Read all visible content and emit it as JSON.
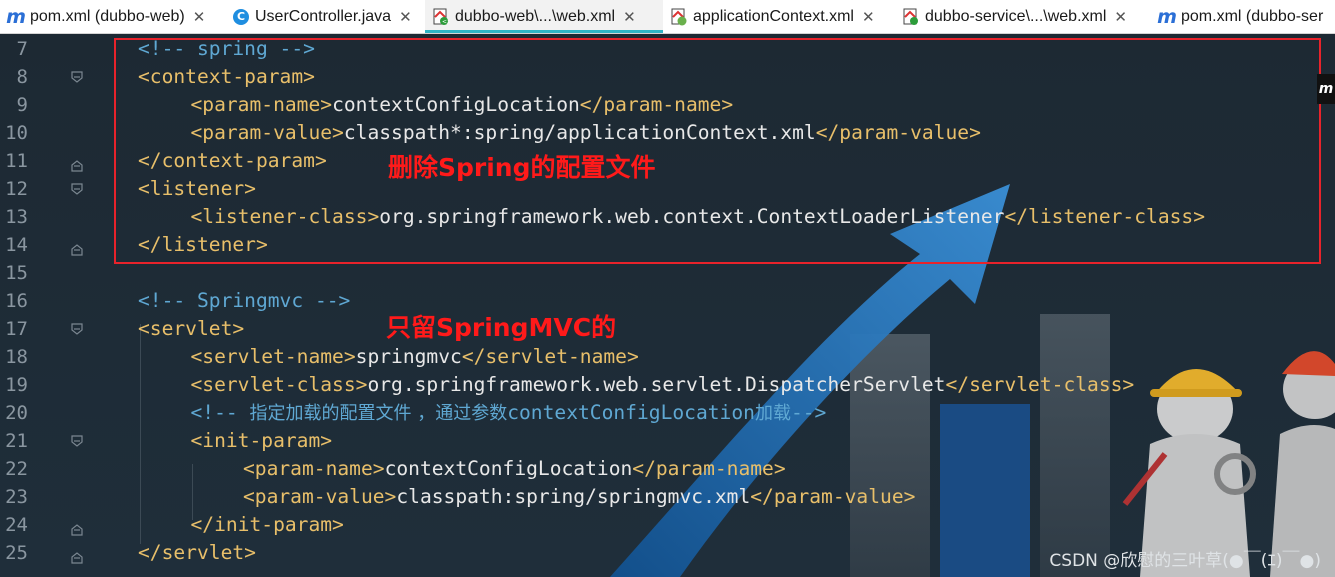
{
  "tabs": [
    {
      "label": "pom.xml (dubbo-web)",
      "icon": "maven-icon",
      "active": false
    },
    {
      "label": "UserController.java",
      "icon": "java-class-icon",
      "active": false
    },
    {
      "label": "dubbo-web\\...\\web.xml",
      "icon": "web-xml-icon",
      "active": true
    },
    {
      "label": "applicationContext.xml",
      "icon": "spring-xml-icon",
      "active": false
    },
    {
      "label": "dubbo-service\\...\\web.xml",
      "icon": "web-xml-icon",
      "active": false
    },
    {
      "label": "pom.xml (dubbo-ser",
      "icon": "maven-icon",
      "active": false
    }
  ],
  "editor": {
    "lines": [
      {
        "no": "7",
        "parts": [
          [
            "cm",
            "<!-- spring -->"
          ]
        ]
      },
      {
        "no": "8",
        "parts": [
          [
            "tag",
            "<context-param>"
          ]
        ]
      },
      {
        "no": "9",
        "parts": [
          [
            "tag",
            "<param-name>"
          ],
          [
            "txt",
            "contextConfigLocation"
          ],
          [
            "tag",
            "</param-name>"
          ]
        ]
      },
      {
        "no": "10",
        "parts": [
          [
            "tag",
            "<param-value>"
          ],
          [
            "txt",
            "classpath*:spring/applicationContext.xml"
          ],
          [
            "tag",
            "</param-value>"
          ]
        ]
      },
      {
        "no": "11",
        "parts": [
          [
            "tag",
            "</context-param>"
          ]
        ]
      },
      {
        "no": "12",
        "parts": [
          [
            "tag",
            "<listener>"
          ]
        ]
      },
      {
        "no": "13",
        "parts": [
          [
            "tag",
            "<listener-class>"
          ],
          [
            "txt",
            "org.springframework.web.context.ContextLoaderListener"
          ],
          [
            "tag",
            "</listener-class>"
          ]
        ]
      },
      {
        "no": "14",
        "parts": [
          [
            "tag",
            "</listener>"
          ]
        ]
      },
      {
        "no": "15",
        "parts": []
      },
      {
        "no": "16",
        "parts": [
          [
            "cm",
            "<!-- Springmvc -->"
          ]
        ]
      },
      {
        "no": "17",
        "parts": [
          [
            "tag",
            "<servlet>"
          ]
        ]
      },
      {
        "no": "18",
        "parts": [
          [
            "tag",
            "<servlet-name>"
          ],
          [
            "txt",
            "springmvc"
          ],
          [
            "tag",
            "</servlet-name>"
          ]
        ]
      },
      {
        "no": "19",
        "parts": [
          [
            "tag",
            "<servlet-class>"
          ],
          [
            "txt",
            "org.springframework.web.servlet.DispatcherServlet"
          ],
          [
            "tag",
            "</servlet-class>"
          ]
        ]
      },
      {
        "no": "20",
        "parts": [
          [
            "cm",
            "<!-- "
          ],
          [
            "cm-cn",
            "指定加载的配置文件 ，通过参数"
          ],
          [
            "cm",
            "contextConfigLocation"
          ],
          [
            "cm-cn",
            "加载"
          ],
          [
            "cm",
            "-->"
          ]
        ]
      },
      {
        "no": "21",
        "parts": [
          [
            "tag",
            "<init-param>"
          ]
        ]
      },
      {
        "no": "22",
        "parts": [
          [
            "tag",
            "<param-name>"
          ],
          [
            "txt",
            "contextConfigLocation"
          ],
          [
            "tag",
            "</param-name>"
          ]
        ]
      },
      {
        "no": "23",
        "parts": [
          [
            "tag",
            "<param-value>"
          ],
          [
            "txt",
            "classpath:spring/springmvc.xml"
          ],
          [
            "tag",
            "</param-value>"
          ]
        ]
      },
      {
        "no": "24",
        "parts": [
          [
            "tag",
            "</init-param>"
          ]
        ]
      },
      {
        "no": "25",
        "parts": [
          [
            "tag",
            "</servlet>"
          ]
        ]
      }
    ]
  },
  "annotations": {
    "delete_note": "删除Spring的配置文件",
    "keep_note": "只留SpringMVC的"
  },
  "side_tab_label": "m",
  "watermark": "CSDN @欣慰的三叶草(●￣(ｴ)￣●)",
  "colors": {
    "tag": "#e8bf6a",
    "comment": "#5fa8d3",
    "text": "#e8e8e8",
    "highlight_box": "#e8232b",
    "annotation": "#ff1a1a",
    "active_tab_underline": "#2fb3c4"
  }
}
